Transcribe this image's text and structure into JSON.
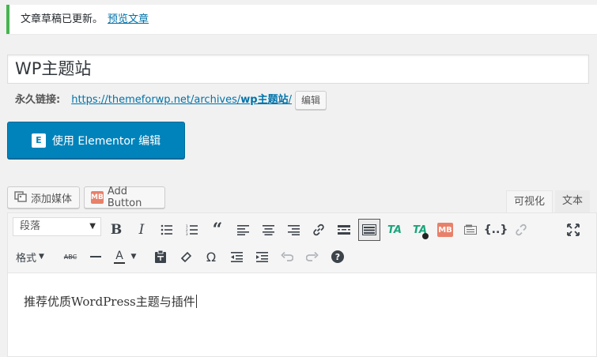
{
  "notice": {
    "message": "文章草稿已更新。",
    "link": "预览文章"
  },
  "post": {
    "title": "WP主题站"
  },
  "permalink": {
    "label": "永久链接:",
    "url_base": "https://themeforwp.net/archives/",
    "slug": "wp主题站",
    "url_tail": "/",
    "edit_label": "编辑"
  },
  "elementor": {
    "label": "使用 Elementor 编辑",
    "logo": "E"
  },
  "media": {
    "add_media": "添加媒体",
    "add_button": "Add Button",
    "mb_icon": "MB"
  },
  "tabs": {
    "visual": "可视化",
    "text": "文本"
  },
  "toolbar": {
    "format_select": "段落",
    "formats_menu": "格式",
    "ta_label": "TA",
    "mb_label": "MB",
    "code_label": "{..}",
    "strike_label": "ABC",
    "color_label": "A",
    "omega": "Ω",
    "help": "?",
    "icons": [
      "bold-icon",
      "italic-icon",
      "bullet-list-icon",
      "numbered-list-icon",
      "blockquote-icon",
      "align-left-icon",
      "align-center-icon",
      "align-right-icon",
      "link-icon",
      "more-tag-icon",
      "toolbar-toggle-icon",
      "ta-icon",
      "ta-plus-icon",
      "mb-icon",
      "shortcode-icon",
      "code-icon",
      "unlink-icon",
      "fullscreen-icon",
      "strikethrough-icon",
      "horizontal-rule-icon",
      "text-color-icon",
      "paste-text-icon",
      "clear-format-icon",
      "special-char-icon",
      "outdent-icon",
      "indent-icon",
      "undo-icon",
      "redo-icon",
      "help-icon"
    ]
  },
  "editor": {
    "content": "推荐优质WordPress主题与插件"
  }
}
